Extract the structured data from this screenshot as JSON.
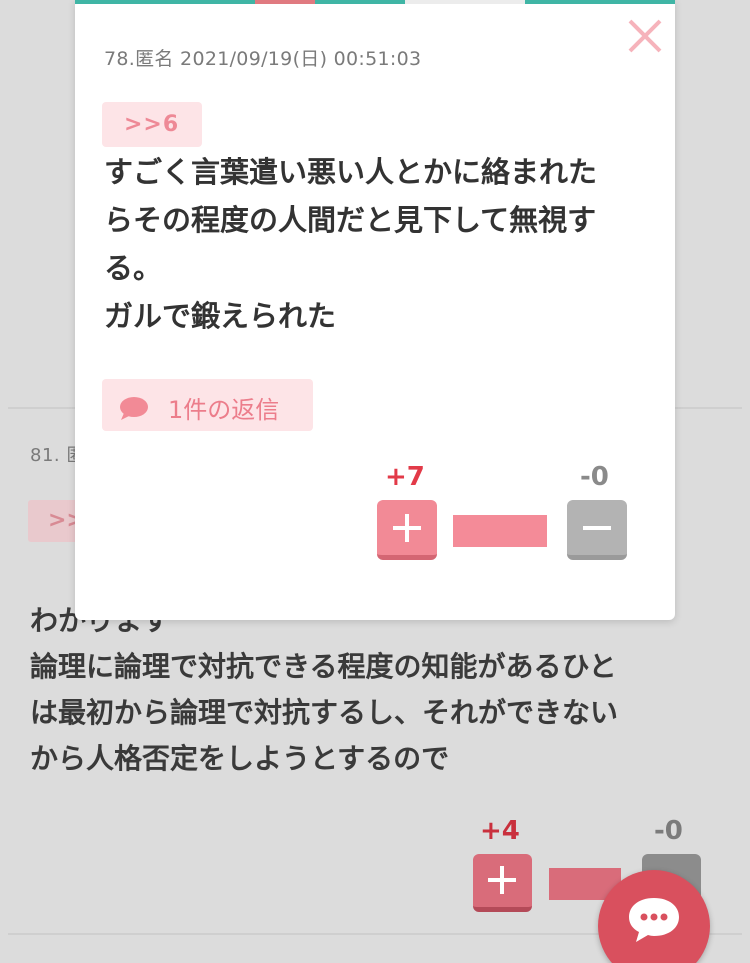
{
  "popup": {
    "meta": "78.匿名 2021/09/19(日) 00:51:03",
    "anchor": ">>6",
    "body_lines": [
      "すごく言葉遣い悪い人とかに絡まれた",
      "らその程度の人間だと見下して無視す",
      "る。",
      "ガルで鍛えられた"
    ],
    "reply_label": "1件の返信",
    "plus_count": "+7",
    "minus_count": "-0",
    "close_icon": "close-icon"
  },
  "background_post": {
    "meta": "81. 匿",
    "anchor": ">>",
    "body_lines": [
      "わかります",
      "論理に論理で対抗できる程度の知能があるひと",
      "は最初から論理で対抗するし、それができない",
      "から人格否定をしようとするので"
    ],
    "plus_count": "+4",
    "minus_count": "-0"
  },
  "colors": {
    "accent_pink": "#f28a96",
    "plus_red": "#e23a48",
    "fab_red": "#d9505e"
  },
  "fab_icon": "chat-bubble-icon"
}
